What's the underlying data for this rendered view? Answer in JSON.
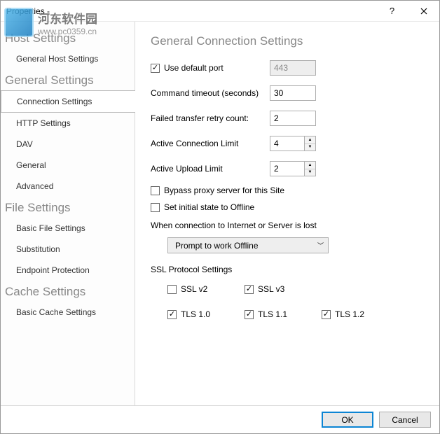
{
  "titlebar": {
    "title": "Properties -"
  },
  "watermark": {
    "cn": "河东软件园",
    "url": "www.pc0359.cn"
  },
  "sidebar": {
    "groups": [
      {
        "header": "Host Settings",
        "items": [
          {
            "label": "General Host Settings",
            "selected": false
          }
        ]
      },
      {
        "header": "General Settings",
        "items": [
          {
            "label": "Connection Settings",
            "selected": true
          },
          {
            "label": "HTTP Settings",
            "selected": false
          },
          {
            "label": "DAV",
            "selected": false
          },
          {
            "label": "General",
            "selected": false
          },
          {
            "label": "Advanced",
            "selected": false
          }
        ]
      },
      {
        "header": "File Settings",
        "items": [
          {
            "label": "Basic File Settings",
            "selected": false
          },
          {
            "label": "Substitution",
            "selected": false
          },
          {
            "label": "Endpoint Protection",
            "selected": false
          }
        ]
      },
      {
        "header": "Cache Settings",
        "items": [
          {
            "label": "Basic Cache Settings",
            "selected": false
          }
        ]
      }
    ]
  },
  "content": {
    "title": "General Connection Settings",
    "useDefaultPort": {
      "label": "Use default port",
      "checked": true,
      "value": "443"
    },
    "commandTimeout": {
      "label": "Command timeout (seconds)",
      "value": "30"
    },
    "retryCount": {
      "label": "Failed transfer retry count:",
      "value": "2"
    },
    "activeConnLimit": {
      "label": "Active Connection Limit",
      "value": "4"
    },
    "activeUploadLimit": {
      "label": "Active Upload Limit",
      "value": "2"
    },
    "bypassProxy": {
      "label": "Bypass proxy server for this Site",
      "checked": false
    },
    "initialOffline": {
      "label": "Set initial state to Offline",
      "checked": false
    },
    "connLostLabel": "When connection to Internet or Server is lost",
    "connLostValue": "Prompt to work Offline",
    "sslHeader": "SSL Protocol Settings",
    "ssl": {
      "sslv2": {
        "label": "SSL v2",
        "checked": false
      },
      "sslv3": {
        "label": "SSL v3",
        "checked": true
      },
      "tls10": {
        "label": "TLS 1.0",
        "checked": true
      },
      "tls11": {
        "label": "TLS 1.1",
        "checked": true
      },
      "tls12": {
        "label": "TLS 1.2",
        "checked": true
      }
    }
  },
  "footer": {
    "ok": "OK",
    "cancel": "Cancel"
  }
}
